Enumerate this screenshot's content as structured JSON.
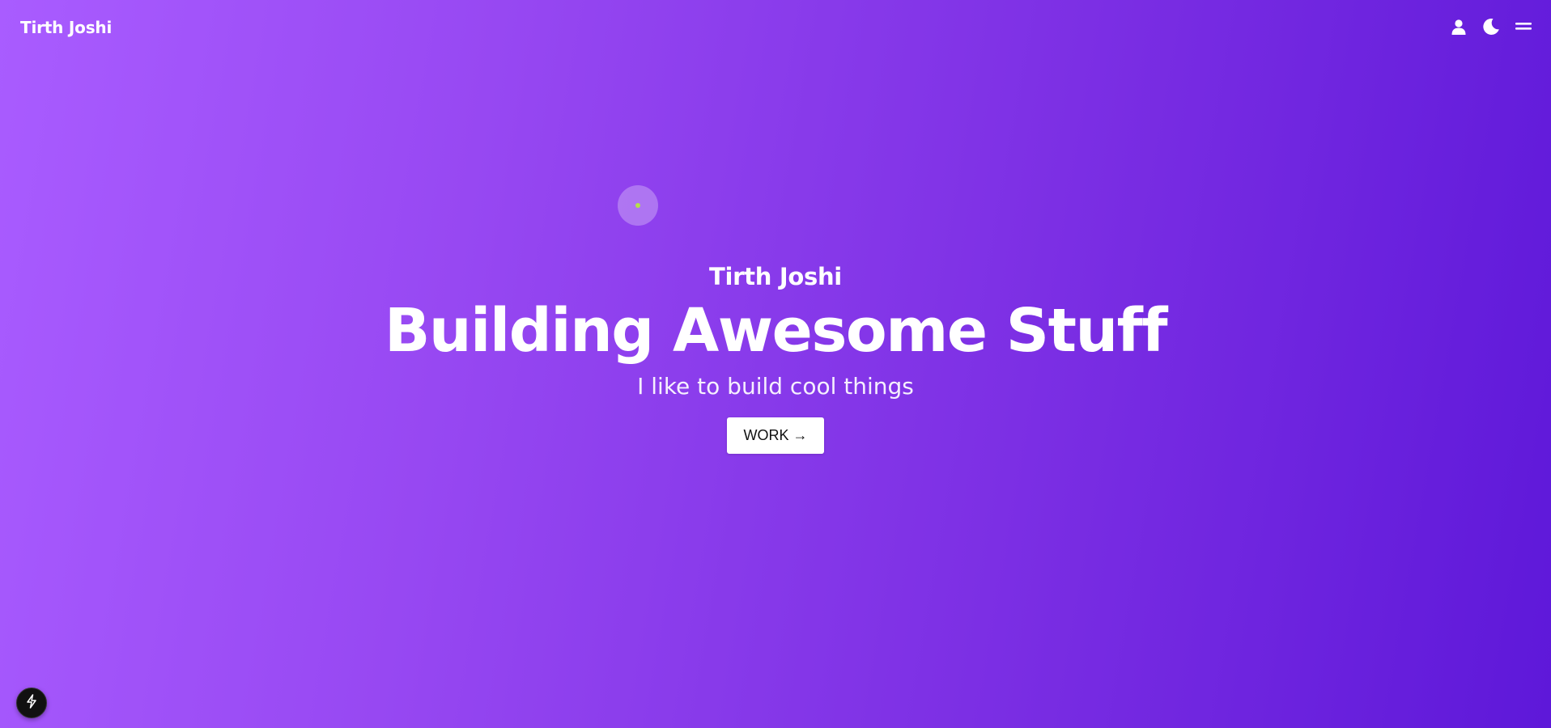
{
  "header": {
    "brand": "Tirth Joshi",
    "icons": [
      "user-icon",
      "moon-icon",
      "menu-icon"
    ]
  },
  "hero": {
    "name": "Tirth Joshi",
    "title": "Building Awesome Stuff",
    "subtitle": "I like to build cool things",
    "cta_label": "WORK →"
  },
  "floating": {
    "bolt_icon": "lightning-bolt-icon"
  },
  "colors": {
    "gradient_start": "#a95cff",
    "gradient_end": "#5e18d9",
    "cursor_dot": "#b5e04a",
    "button_bg": "#ffffff"
  }
}
